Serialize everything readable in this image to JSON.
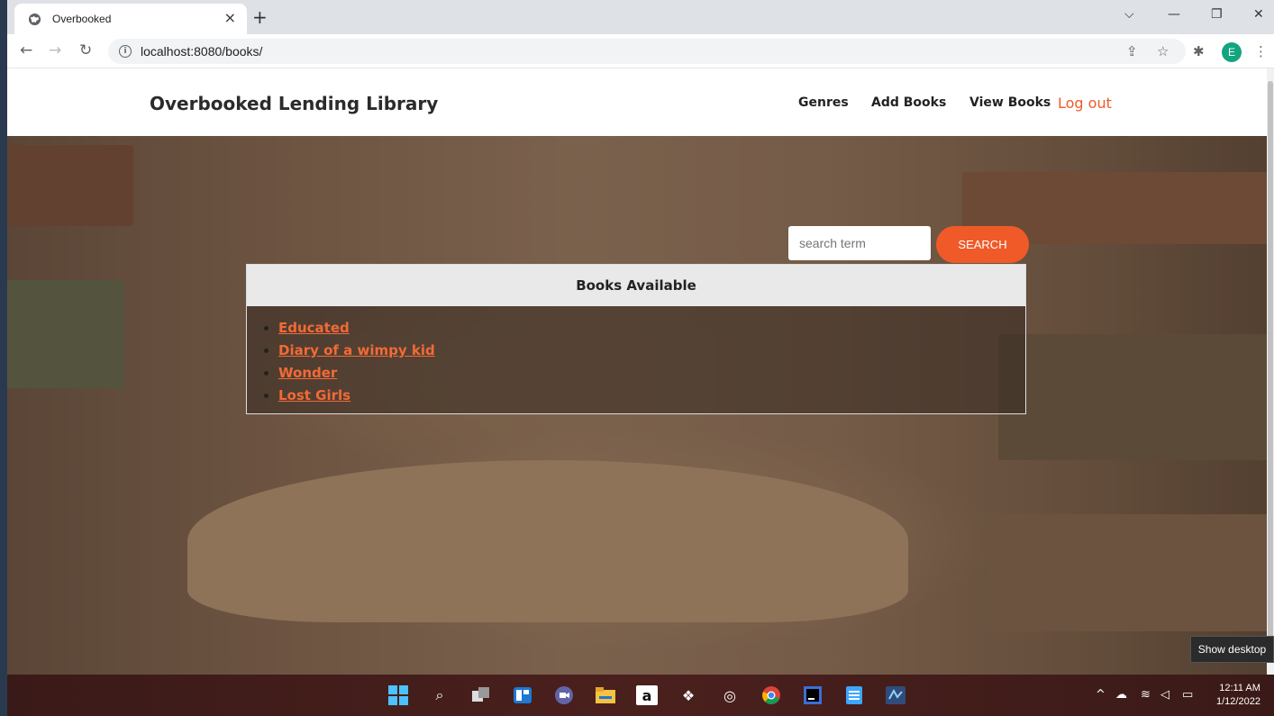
{
  "browser": {
    "tab_title": "Overbooked",
    "tab_close": "×",
    "new_tab": "+",
    "url": "localhost:8080/books/",
    "profile_initial": "E",
    "window_controls": {
      "dropdown": "⌵",
      "minimize": "—",
      "restore": "❐",
      "close": "✕"
    }
  },
  "site": {
    "brand": "Overbooked Lending Library",
    "nav": {
      "genres": "Genres",
      "add_books": "Add Books",
      "view_books": "View Books",
      "logout": "Log out"
    },
    "search": {
      "placeholder": "search term",
      "button": "SEARCH"
    },
    "books": {
      "heading": "Books Available",
      "items": [
        "Educated",
        "Diary of a wimpy kid",
        "Wonder",
        "Lost Girls"
      ]
    }
  },
  "taskbar": {
    "time": "12:11 AM",
    "date": "1/12/2022",
    "tooltip": "Show desktop"
  },
  "colors": {
    "accent": "#f05a28",
    "link": "#f26a36",
    "avatar": "#12a57f"
  }
}
